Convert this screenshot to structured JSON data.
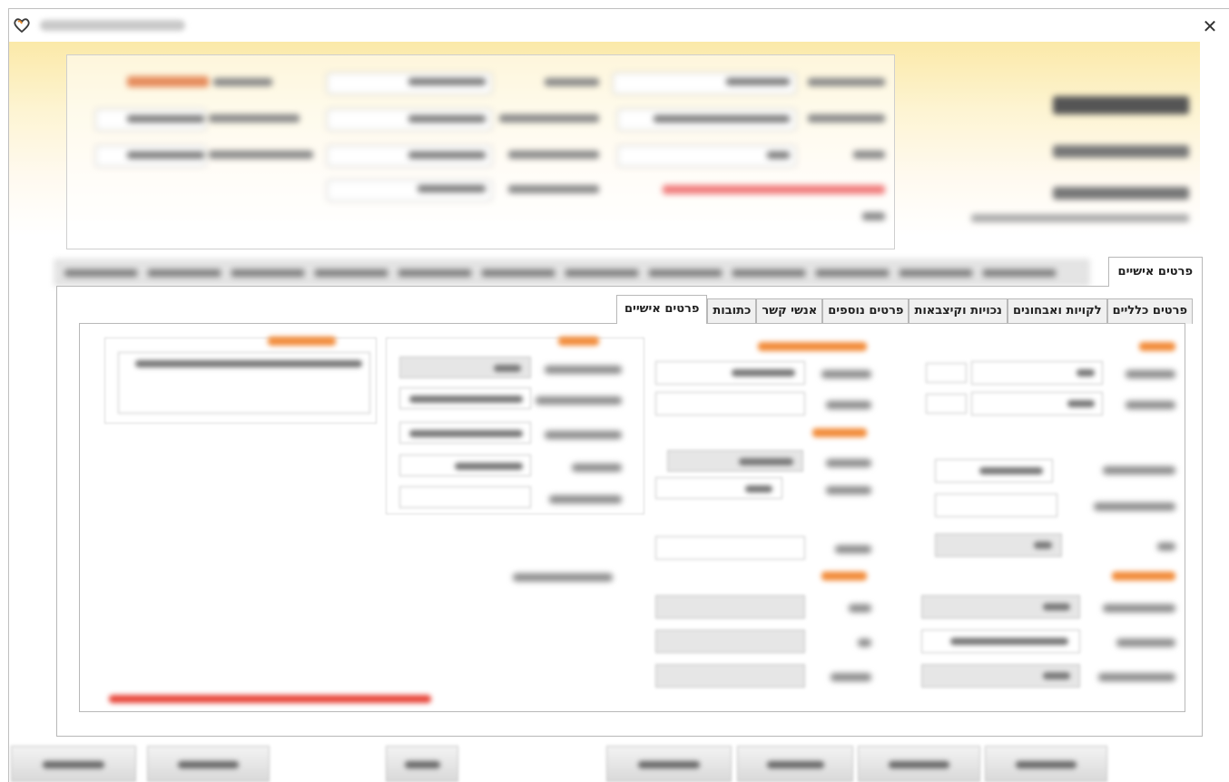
{
  "window": {
    "close_glyph": "✕",
    "icon": "heart-logo-icon"
  },
  "tabs": {
    "main_active": "פרטים אישיים",
    "sub": [
      "פרטים אישיים",
      "כתובות",
      "אנשי קשר",
      "פרטים נוספים",
      "נכויות וקיצבאות",
      "לקויות ואבחונים",
      "פרטים כלליים"
    ],
    "sub_active_index": 0
  },
  "colors": {
    "header_gradient_top": "#fbe9a8",
    "section_title": "#f28c3a",
    "error_text": "#e8463a",
    "active_tab_bg": "#ffffff"
  }
}
